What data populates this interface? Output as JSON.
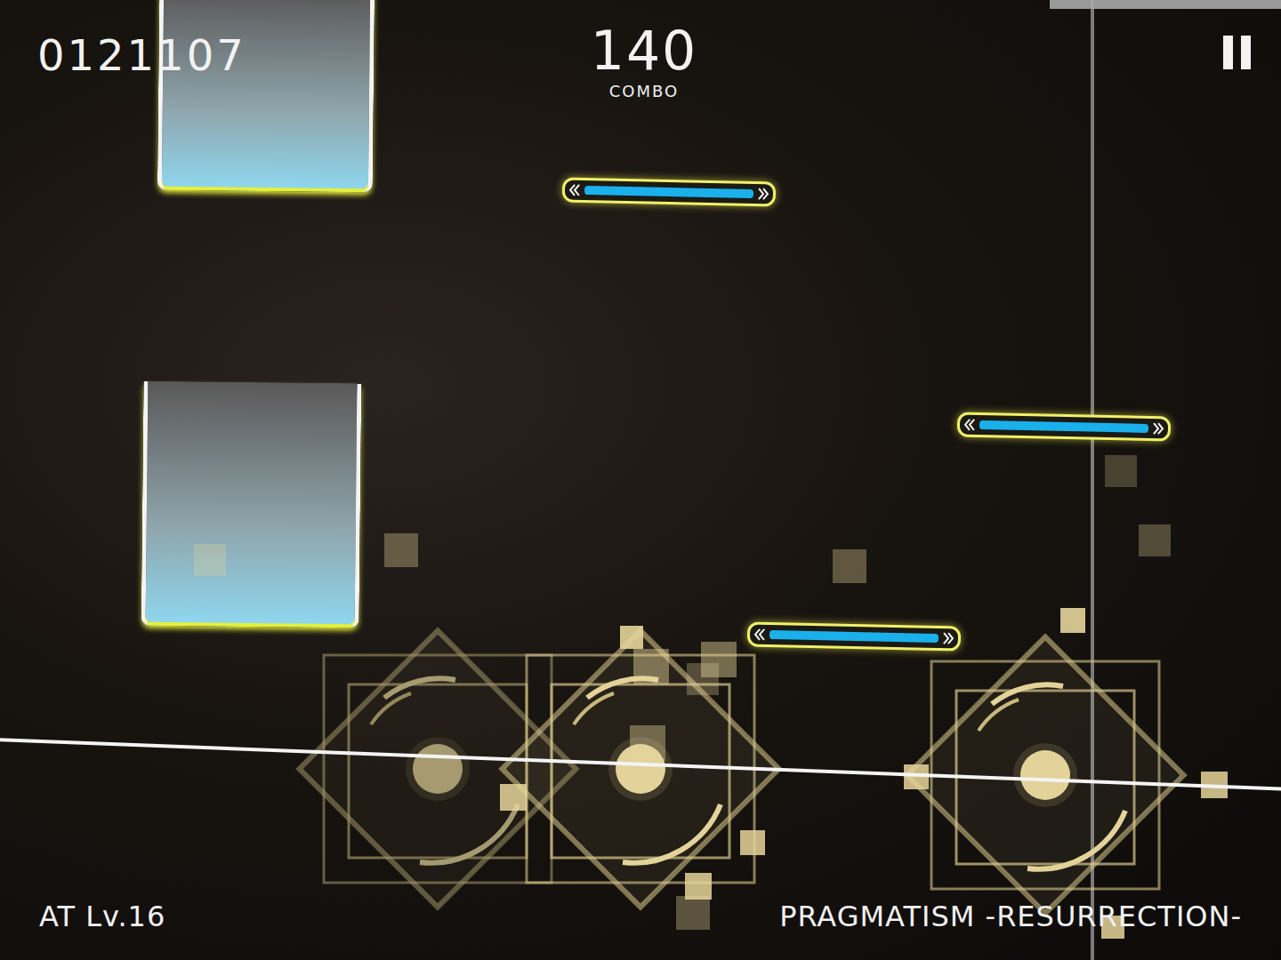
{
  "hud": {
    "score": "0121107",
    "combo": "140",
    "combo_label": "COMBO"
  },
  "chart": {
    "difficulty": "AT Lv.16",
    "title": "PRAGMATISM -RESURRECTION-"
  },
  "notes": [
    {
      "kind": "hold"
    },
    {
      "kind": "hold"
    },
    {
      "kind": "flick"
    },
    {
      "kind": "flick"
    },
    {
      "kind": "flick"
    },
    {
      "kind": "tap"
    },
    {
      "kind": "tap"
    },
    {
      "kind": "tap"
    }
  ]
}
